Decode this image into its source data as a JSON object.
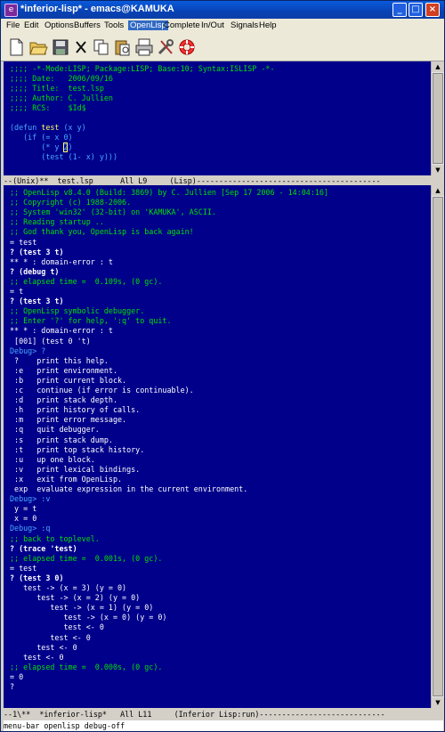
{
  "window": {
    "title": "*inferior-lisp* - emacs@KAMUKA",
    "app_icon": "emacs-icon",
    "buttons": [
      "minimize",
      "maximize",
      "close"
    ]
  },
  "menubar": {
    "items": [
      "File",
      "Edit",
      "Options",
      "Buffers",
      "Tools",
      "OpenLisp",
      "Complete",
      "In/Out",
      "Signals",
      "Help"
    ],
    "active": "OpenLisp"
  },
  "toolbar": {
    "icons": [
      "new-file-icon",
      "open-folder-icon",
      "save-icon",
      "cut-icon",
      "copy-icon",
      "paste-icon",
      "print-icon",
      "tools-icon",
      "help-lifebuoy-icon"
    ]
  },
  "editor": {
    "lines": [
      {
        "text": ";;;; -*-Mode:LISP; Package:LISP; Base:10; Syntax:ISLISP -*-",
        "style": "comment"
      },
      {
        "text": ";;;; Date:   2006/09/16",
        "style": "comment"
      },
      {
        "text": ";;;; Title:  test.lsp",
        "style": "comment"
      },
      {
        "text": ";;;; Author: C. Jullien",
        "style": "comment"
      },
      {
        "text": ";;;; RCS:    $Id$",
        "style": "comment"
      },
      {
        "text": "",
        "style": "text"
      },
      {
        "text": "(defun test (x y)",
        "style": "code"
      },
      {
        "text": "   (if (= x 0)",
        "style": "code"
      },
      {
        "text": "       (* y 2)",
        "style": "code"
      },
      {
        "text": "       (test (1- x) y)))",
        "style": "code"
      }
    ],
    "modeline": "--(Unix)**  test.lsp      All L9     (Lisp)-----------------------------------------"
  },
  "repl": {
    "lines": [
      {
        "text": ";; OpenLisp v8.4.0 (Build: 3869) by C. Jullien [Sep 17 2006 - 14:04:16]",
        "style": "comment"
      },
      {
        "text": ";; Copyright (c) 1988-2006.",
        "style": "comment"
      },
      {
        "text": ";; System 'win32' (32-bit) on 'KAMUKA', ASCII.",
        "style": "comment"
      },
      {
        "text": ";; Reading startup ..",
        "style": "comment"
      },
      {
        "text": ";; God thank you, OpenLisp is back again!",
        "style": "comment"
      },
      {
        "text": "= test",
        "style": "text"
      },
      {
        "text": "? (test 3 t)",
        "style": "bold"
      },
      {
        "text": "** * : domain-error : t",
        "style": "text"
      },
      {
        "text": "? (debug t)",
        "style": "bold"
      },
      {
        "text": ";; elapsed time =  0.109s, (0 gc).",
        "style": "comment"
      },
      {
        "text": "= t",
        "style": "text"
      },
      {
        "text": "? (test 3 t)",
        "style": "bold"
      },
      {
        "text": ";; OpenLisp symbolic debugger.",
        "style": "comment"
      },
      {
        "text": ";; Enter '?' for help, ':q' to quit.",
        "style": "comment"
      },
      {
        "text": "** * : domain-error : t",
        "style": "text"
      },
      {
        "text": " [001] (test 0 't)",
        "style": "text"
      },
      {
        "text": "Debug> ?",
        "style": "prompt"
      },
      {
        "text": " ?    print this help.",
        "style": "text"
      },
      {
        "text": " :e   print environment.",
        "style": "text"
      },
      {
        "text": " :b   print current block.",
        "style": "text"
      },
      {
        "text": " :c   continue (if error is continuable).",
        "style": "text"
      },
      {
        "text": " :d   print stack depth.",
        "style": "text"
      },
      {
        "text": " :h   print history of calls.",
        "style": "text"
      },
      {
        "text": " :m   print error message.",
        "style": "text"
      },
      {
        "text": " :q   quit debugger.",
        "style": "text"
      },
      {
        "text": " :s   print stack dump.",
        "style": "text"
      },
      {
        "text": " :t   print top stack history.",
        "style": "text"
      },
      {
        "text": " :u   up one block.",
        "style": "text"
      },
      {
        "text": " :v   print lexical bindings.",
        "style": "text"
      },
      {
        "text": " :x   exit from OpenLisp.",
        "style": "text"
      },
      {
        "text": " exp  evaluate expression in the current environment.",
        "style": "text"
      },
      {
        "text": "Debug> :v",
        "style": "prompt"
      },
      {
        "text": " y = t",
        "style": "text"
      },
      {
        "text": " x = 0",
        "style": "text"
      },
      {
        "text": "Debug> :q",
        "style": "prompt"
      },
      {
        "text": ";; back to toplevel.",
        "style": "comment"
      },
      {
        "text": "? (trace 'test)",
        "style": "bold"
      },
      {
        "text": ";; elapsed time =  0.001s, (0 gc).",
        "style": "comment"
      },
      {
        "text": "= test",
        "style": "text"
      },
      {
        "text": "? (test 3 0)",
        "style": "bold"
      },
      {
        "text": "   test -> (x = 3) (y = 0)",
        "style": "text"
      },
      {
        "text": "      test -> (x = 2) (y = 0)",
        "style": "text"
      },
      {
        "text": "         test -> (x = 1) (y = 0)",
        "style": "text"
      },
      {
        "text": "            test -> (x = 0) (y = 0)",
        "style": "text"
      },
      {
        "text": "            test <- 0",
        "style": "text"
      },
      {
        "text": "         test <- 0",
        "style": "text"
      },
      {
        "text": "      test <- 0",
        "style": "text"
      },
      {
        "text": "   test <- 0",
        "style": "text"
      },
      {
        "text": ";; elapsed time =  0.000s, (0 gc).",
        "style": "comment"
      },
      {
        "text": "= 0",
        "style": "text"
      },
      {
        "text": "?",
        "style": "text"
      }
    ],
    "modeline": "--1\\**  *inferior-lisp*   All L11     (Inferior Lisp:run)----------------------------"
  },
  "minibuffer": "menu-bar openlisp debug-off",
  "colors": {
    "background": "#00008b",
    "comment": "#00e000",
    "keyword": "#4aa8ff",
    "function_name": "#ffff60",
    "text": "#ffffff",
    "titlebar": "#0842b4"
  }
}
